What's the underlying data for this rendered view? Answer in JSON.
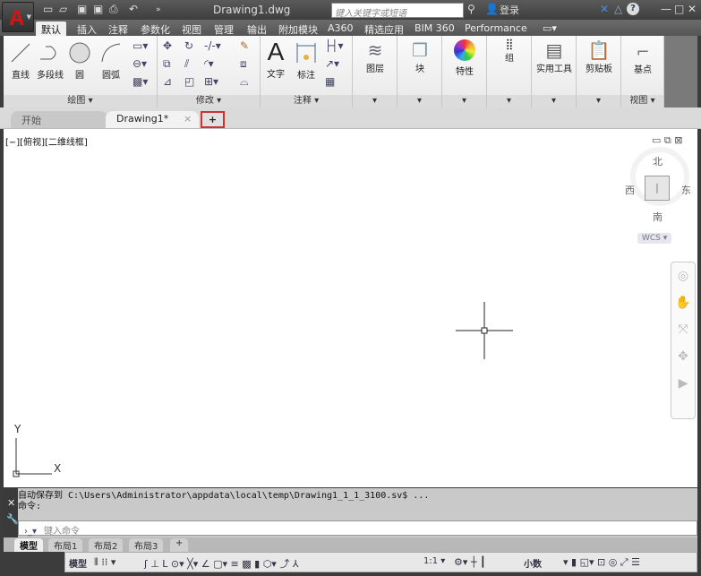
{
  "title_bar": {
    "doc_title": "Drawing1.dwg",
    "search_placeholder": "键入关键字或短语",
    "sign_in": "登录",
    "help": "?",
    "minimize": "—",
    "maximize": "□",
    "close": "✕"
  },
  "ribbon_tabs": [
    "默认",
    "插入",
    "注释",
    "参数化",
    "视图",
    "管理",
    "输出",
    "附加模块",
    "A360",
    "精选应用",
    "BIM 360",
    "Performance"
  ],
  "panels": {
    "draw": {
      "title": "绘图 ▾",
      "tools": [
        "直线",
        "多段线",
        "圆",
        "圆弧"
      ]
    },
    "modify": {
      "title": "修改 ▾"
    },
    "annotate": {
      "title": "注释 ▾",
      "tools": [
        "文字",
        "标注"
      ]
    },
    "layers": "图层",
    "block": "块",
    "properties": "特性",
    "group": "组",
    "utilities": "实用工具",
    "clipboard": "剪贴板",
    "view": {
      "tool": "基点",
      "title": "视图 ▾"
    }
  },
  "doc_tabs": {
    "start": "开始",
    "active": "Drawing1*",
    "close": "×",
    "new": "+"
  },
  "viewport": {
    "label": "[−][俯视][二维线框]",
    "compass": {
      "n": "北",
      "s": "南",
      "e": "东",
      "w": "西"
    },
    "wcs": "WCS ▾",
    "ucs_x": "X",
    "ucs_y": "Y"
  },
  "command": {
    "history": [
      "自动保存到 C:\\Users\\Administrator\\appdata\\local\\temp\\Drawing1_1_1_3100.sv$ ...",
      "命令:"
    ],
    "placeholder": "键入命令"
  },
  "layout_tabs": [
    "模型",
    "布局1",
    "布局2",
    "布局3",
    "+"
  ],
  "status": {
    "model": "模型",
    "scale": "1:1 ▾",
    "units": "小数"
  }
}
